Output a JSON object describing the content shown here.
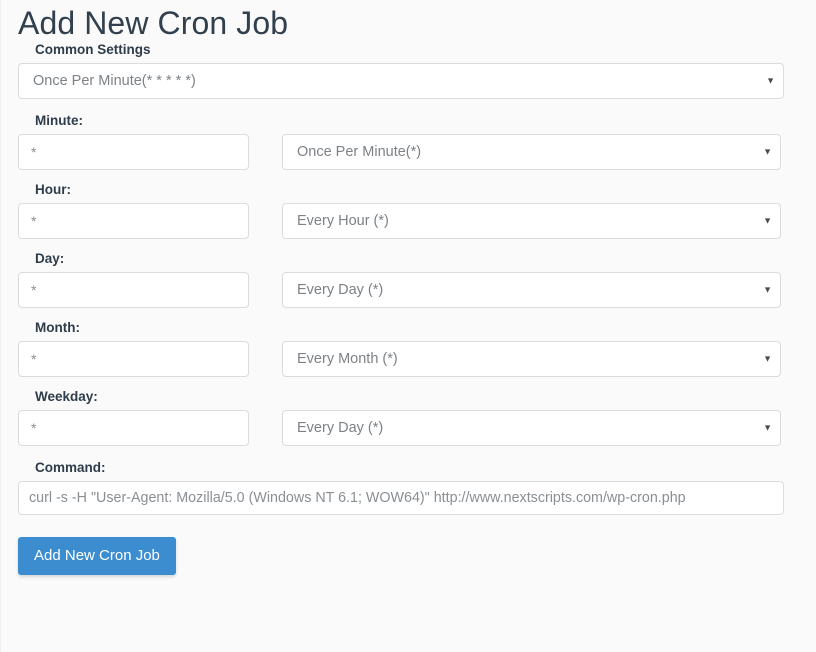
{
  "header": {
    "title": "Add New Cron Job"
  },
  "form": {
    "common_settings": {
      "label": "Common Settings",
      "selected": "Once Per Minute(* * * * *)",
      "arrow": "▼"
    },
    "rows": [
      {
        "label": "Minute:",
        "value": "*",
        "placeholder": "*",
        "selected": "Once Per Minute(*)",
        "arrow": "▼"
      },
      {
        "label": "Hour:",
        "value": "*",
        "placeholder": "*",
        "selected": "Every Hour (*)",
        "arrow": "▼"
      },
      {
        "label": "Day:",
        "value": "*",
        "placeholder": "*",
        "selected": "Every Day (*)",
        "arrow": "▼"
      },
      {
        "label": "Month:",
        "value": "*",
        "placeholder": "*",
        "selected": "Every Month (*)",
        "arrow": "▼"
      },
      {
        "label": "Weekday:",
        "value": "*",
        "placeholder": "*",
        "selected": "Every Day (*)",
        "arrow": "▼"
      }
    ],
    "command": {
      "label": "Command:",
      "value": "curl -s -H \"User-Agent: Mozilla/5.0 (Windows NT 6.1; WOW64)\" http://www.nextscripts.com/wp-cron.php"
    },
    "submit": {
      "label": "Add New Cron Job",
      "color": "#3b8dd0"
    }
  }
}
